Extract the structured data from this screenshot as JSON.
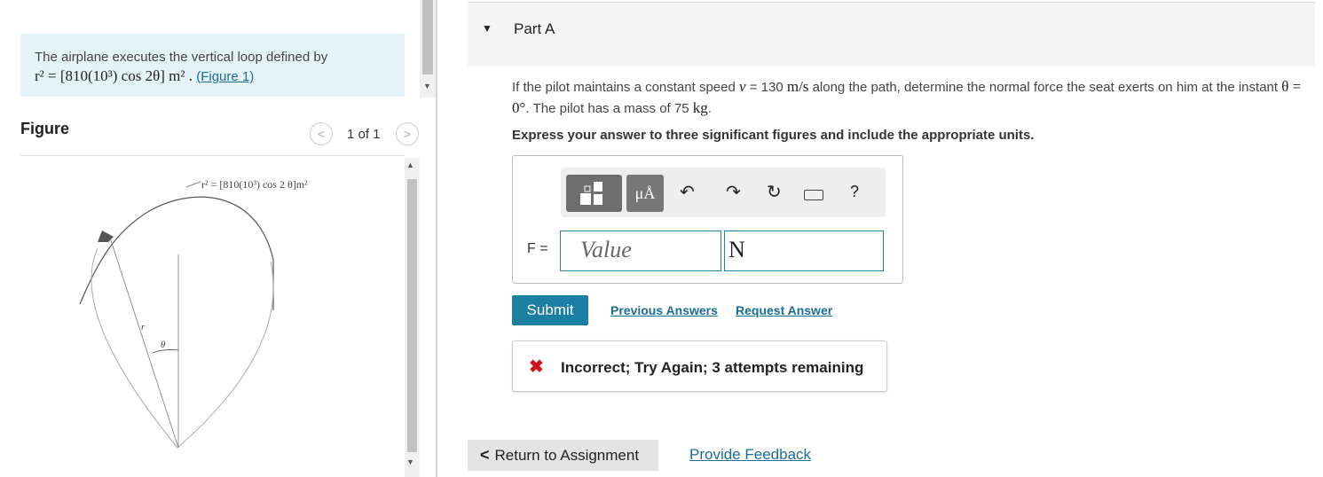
{
  "problem": {
    "statement": "The airplane executes the vertical loop defined by",
    "equation": "r² = [810(10³) cos 2θ] m²",
    "figure_link": "(Figure 1)"
  },
  "figure_panel": {
    "heading": "Figure",
    "count": "1 of 1",
    "prev_icon": "chevron-left-icon",
    "next_icon": "chevron-right-icon",
    "equation_label": "r² = [810(10³) cos 2 θ]m²",
    "r_label": "r",
    "theta_label": "θ"
  },
  "part": {
    "title": "Part A",
    "question_pre": "If the pilot maintains a constant speed ",
    "speed_var": "v",
    "speed_val": " = 130 ",
    "speed_unit": "m/s",
    "question_mid": " along the path, determine the normal force the seat exerts on him at the instant ",
    "theta_expr": "θ = 0°",
    "question_mid2": ". The pilot has a mass of 75 ",
    "mass_unit": "kg",
    "question_end": ".",
    "instruction": "Express your answer to three significant figures and include the appropriate units."
  },
  "answer": {
    "toolbar_units_glyph": "μÅ",
    "undo_glyph": "↶",
    "redo_glyph": "↷",
    "reset_glyph": "↻",
    "help_glyph": "?",
    "variable_label": "F =",
    "value_placeholder": "Value",
    "units_value": "N"
  },
  "actions": {
    "submit": "Submit",
    "previous_answers": "Previous Answers",
    "request_answer": "Request Answer"
  },
  "feedback": {
    "icon": "✖",
    "text": "Incorrect; Try Again; 3 attempts remaining"
  },
  "footer": {
    "return_label": "Return to Assignment",
    "provide_feedback": "Provide Feedback"
  },
  "colors": {
    "problem_bg": "#e4f3f7",
    "accent": "#1b7fa4",
    "error": "#d0121b"
  }
}
